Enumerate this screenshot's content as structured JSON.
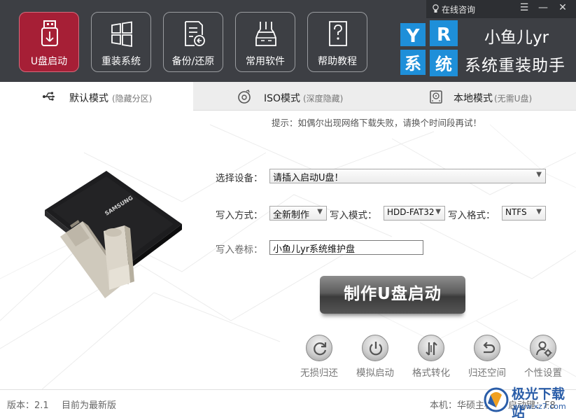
{
  "header": {
    "consult": "在线咨询",
    "menu_glyph": "☰",
    "minimize_glyph": "—",
    "close_glyph": "✕",
    "tools": [
      {
        "label": "U盘启动",
        "icon": "usb-icon",
        "active": true
      },
      {
        "label": "重装系统",
        "icon": "windows-icon",
        "active": false
      },
      {
        "label": "备份/还原",
        "icon": "backup-icon",
        "active": false
      },
      {
        "label": "常用软件",
        "icon": "software-icon",
        "active": false
      },
      {
        "label": "帮助教程",
        "icon": "help-icon",
        "active": false
      }
    ],
    "brand": {
      "logo_letters": [
        "Y",
        "R",
        "系",
        "统"
      ],
      "name": "小鱼儿yr",
      "subtitle": "系统重装助手"
    }
  },
  "tabs": [
    {
      "label": "默认模式",
      "sub": "(隐藏分区)",
      "icon": "usb-plug-icon",
      "active": true
    },
    {
      "label": "ISO模式",
      "sub": "(深度隐藏)",
      "icon": "disc-icon",
      "active": false
    },
    {
      "label": "本地模式",
      "sub": "(无需U盘)",
      "icon": "harddisk-icon",
      "active": false
    }
  ],
  "tip": "提示：如偶尔出现网络下载失败，请换个时间段再试！",
  "form": {
    "device_label": "选择设备：",
    "device_value": "请插入启动U盘！",
    "write_method_label": "写入方式：",
    "write_method_value": "全新制作",
    "write_mode_label": "写入模式：",
    "write_mode_value": "HDD-FAT32",
    "write_format_label": "写入格式：",
    "write_format_value": "NTFS",
    "volume_label": "写入卷标：",
    "volume_value": "小鱼儿yr系统维护盘"
  },
  "make_button": "制作U盘启动",
  "actions": [
    {
      "label": "无损归还",
      "icon": "refresh-icon"
    },
    {
      "label": "模拟启动",
      "icon": "power-icon"
    },
    {
      "label": "格式转化",
      "icon": "convert-icon"
    },
    {
      "label": "归还空间",
      "icon": "return-icon"
    },
    {
      "label": "个性设置",
      "icon": "user-settings-icon"
    }
  ],
  "illustration": {
    "ssd_brand": "SAMSUNG"
  },
  "footer": {
    "version": "版本：2.1",
    "update_status": "目前为最新版",
    "machine": "本机：华硕主板",
    "hotkey": "启动键：F8"
  },
  "watermark": {
    "name": "极光下载站",
    "url": "www.xz7.com"
  },
  "colors": {
    "header_bg": "#3d3f44",
    "accent_red": "#a61f36",
    "logo_blue": "#1e8fd9"
  }
}
